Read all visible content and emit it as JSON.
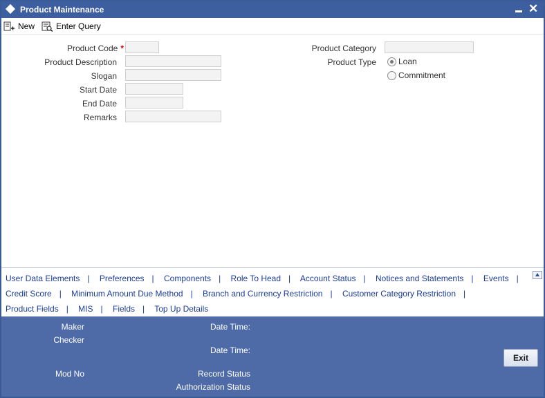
{
  "window": {
    "title": "Product Maintenance",
    "minimize_icon": "minimize-icon",
    "close_icon": "close-icon",
    "close_glyph": "✕"
  },
  "toolbar": {
    "new_label": "New",
    "enter_query_label": "Enter Query"
  },
  "form": {
    "product_code": {
      "label": "Product Code",
      "required_mark": "*",
      "value": ""
    },
    "product_description": {
      "label": "Product Description",
      "value": ""
    },
    "slogan": {
      "label": "Slogan",
      "value": ""
    },
    "start_date": {
      "label": "Start Date",
      "value": ""
    },
    "end_date": {
      "label": "End Date",
      "value": ""
    },
    "remarks": {
      "label": "Remarks",
      "value": ""
    },
    "product_category": {
      "label": "Product Category",
      "value": ""
    },
    "product_type": {
      "label": "Product Type",
      "options": [
        {
          "label": "Loan",
          "selected": true
        },
        {
          "label": "Commitment",
          "selected": false
        }
      ]
    }
  },
  "links": {
    "row1": [
      "User Data Elements",
      "Preferences",
      "Components",
      "Role To Head",
      "Account Status",
      "Notices and Statements",
      "Events"
    ],
    "row2": [
      "Credit Score",
      "Minimum Amount Due Method",
      "Branch and Currency Restriction",
      "Customer Category Restriction"
    ],
    "row3": [
      "Product Fields",
      "MIS",
      "Fields",
      "Top Up Details"
    ],
    "separator": "|"
  },
  "footer": {
    "maker_label": "Maker",
    "checker_label": "Checker",
    "mod_no_label": "Mod No",
    "date_time_label_1": "Date Time:",
    "date_time_label_2": "Date Time:",
    "record_status_label": "Record Status",
    "authorization_status_label": "Authorization Status",
    "exit_label": "Exit"
  },
  "colors": {
    "titlebar": "#3d5fa0",
    "footer": "#4e6ba7",
    "link": "#1c3c98",
    "required": "#d40000"
  }
}
